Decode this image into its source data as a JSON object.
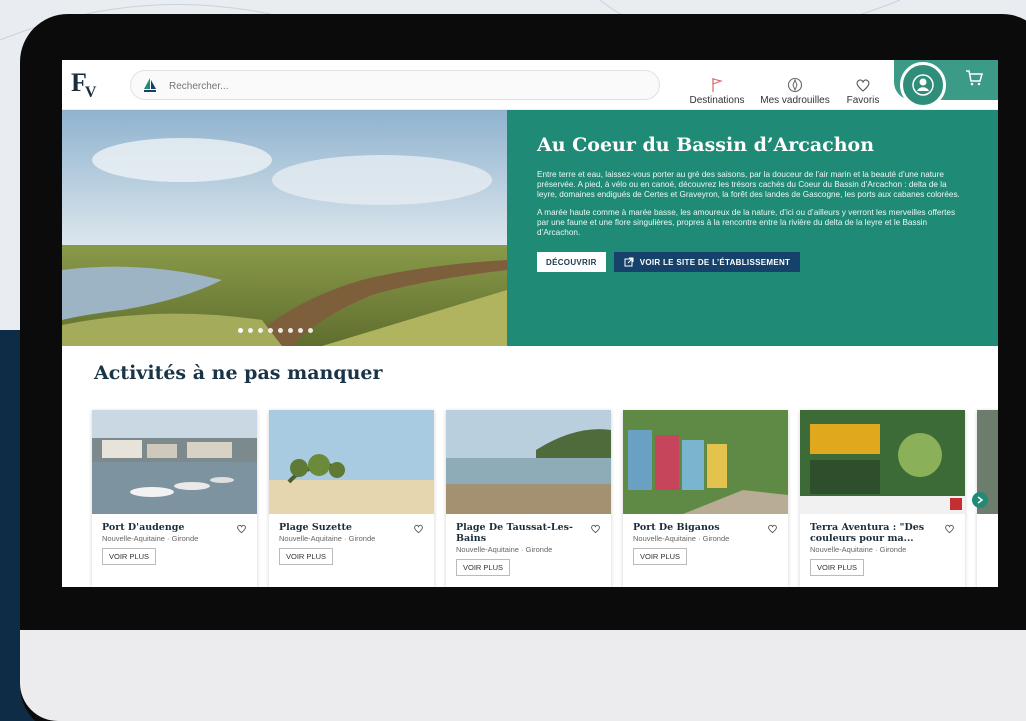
{
  "header": {
    "logo_main": "F",
    "logo_sub": "V",
    "search_placeholder": "Rechercher...",
    "nav": [
      {
        "label": "Destinations",
        "icon": "flag-icon"
      },
      {
        "label": "Mes vadrouilles",
        "icon": "compass-icon"
      },
      {
        "label": "Favoris",
        "icon": "heart-icon"
      }
    ],
    "account_icon": "user-icon",
    "cart_icon": "cart-icon"
  },
  "hero": {
    "title": "Au Coeur du Bassin d’Arcachon",
    "paragraph_1": "Entre terre et eau, laissez-vous porter au gré des saisons, par la douceur de l’air marin et la beauté d’une nature préservée. A pied, à vélo ou en canoé, découvrez les trésors cachés du Coeur du Bassin d’Arcachon : delta de la leyre, domaines endigués de Certes et Graveyron, la forêt des landes de Gascogne, les ports aux cabanes colorées.",
    "paragraph_2": "A marée haute comme à marée basse, les amoureux de la nature, d’ici ou d’ailleurs y verront les merveilles offertes par une faune et une flore singulières, propres à la rencontre entre la rivière du delta de la leyre et le Bassin d’Arcachon.",
    "btn_discover": "DÉCOUVRIR",
    "btn_site": "VOIR LE SITE DE L’ÉTABLISSEMENT",
    "slide_count": 8,
    "active_slide": 1
  },
  "section": {
    "title": "Activités à ne pas manquer"
  },
  "cards": [
    {
      "title": "Port D'audenge",
      "subtitle": "Nouvelle-Aquitaine · Gironde",
      "button": "VOIR PLUS"
    },
    {
      "title": "Plage Suzette",
      "subtitle": "Nouvelle-Aquitaine · Gironde",
      "button": "VOIR PLUS"
    },
    {
      "title": "Plage De Taussat-Les-Bains",
      "subtitle": "Nouvelle-Aquitaine · Gironde",
      "button": "VOIR PLUS"
    },
    {
      "title": "Port De Biganos",
      "subtitle": "Nouvelle-Aquitaine · Gironde",
      "button": "VOIR PLUS"
    },
    {
      "title": "Terra Aventura : \"Des couleurs pour ma...",
      "subtitle": "Nouvelle-Aquitaine · Gironde",
      "button": "VOIR PLUS"
    }
  ],
  "colors": {
    "brand_green": "#1f8a75",
    "navy": "#16416a",
    "text_dark": "#1b2d3b"
  }
}
